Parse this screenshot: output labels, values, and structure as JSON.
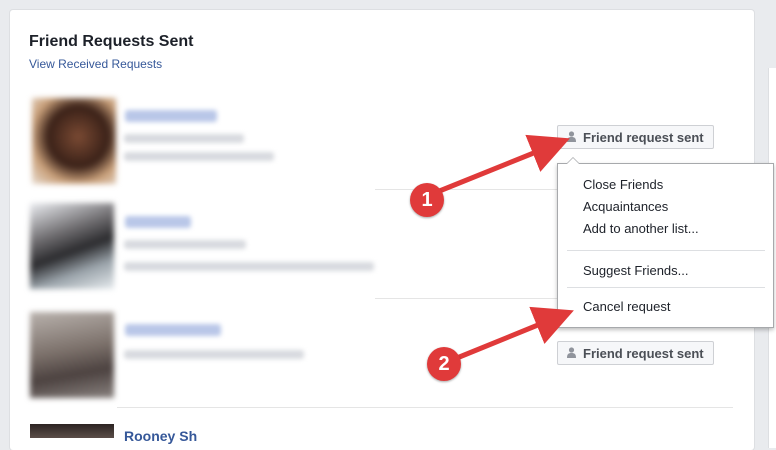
{
  "header": {
    "title": "Friend Requests Sent",
    "view_received_link": "View Received Requests"
  },
  "rows": [
    {
      "button_label": "Friend request sent"
    },
    {
      "button_label": "Friend request sent"
    }
  ],
  "dropdown_menu": {
    "items": [
      "Close Friends",
      "Acquaintances",
      "Add to another list..."
    ],
    "suggest_friends": "Suggest Friends...",
    "cancel_request": "Cancel request"
  },
  "annotations": {
    "callout_1": "1",
    "callout_2": "2",
    "arrow_color": "#e03a3a"
  },
  "partial_bottom_name": "Rooney Sh",
  "colors": {
    "link": "#365899",
    "title": "#1d2129",
    "button_bg": "#f6f7f9",
    "button_border": "#ced0d4",
    "page_bg": "#e9ebee"
  },
  "icons": {
    "friend_button_icon": "person-icon"
  }
}
